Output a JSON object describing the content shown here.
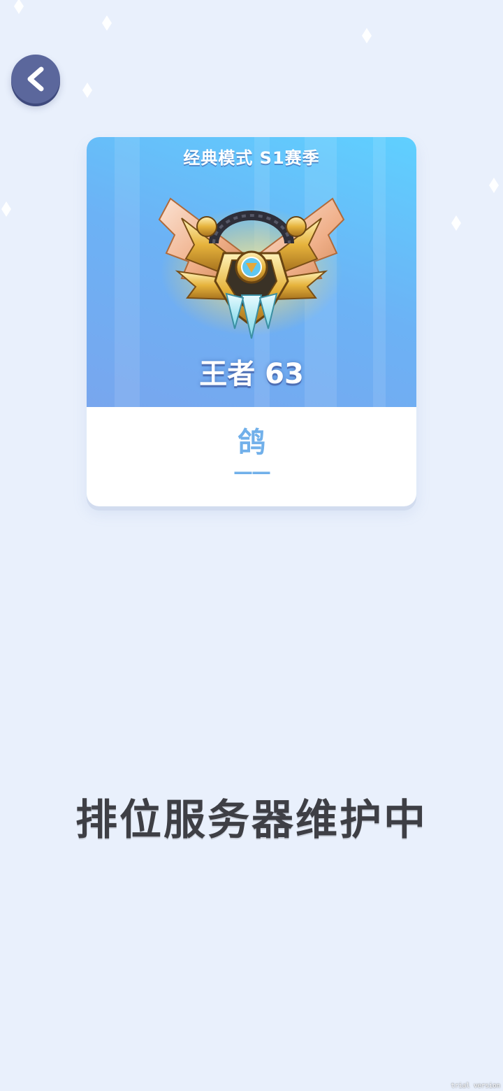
{
  "back_button": {
    "icon": "chevron-left-icon"
  },
  "rank_card": {
    "season_title": "经典模式 S1赛季",
    "rank_label": "王者 63",
    "emblem_icon": "king-rank-emblem-icon",
    "player_name": "鸽",
    "player_subtitle": "——"
  },
  "maintenance_message": "排位服务器维护中",
  "version_tag": "trial version",
  "colors": {
    "background": "#e9f0fc",
    "card_gradient_start": "#78a6ee",
    "card_gradient_end": "#5fd0ff",
    "player_name": "#71b0ea",
    "maintenance_text": "#3e3f45",
    "back_button": "#5b679c"
  }
}
